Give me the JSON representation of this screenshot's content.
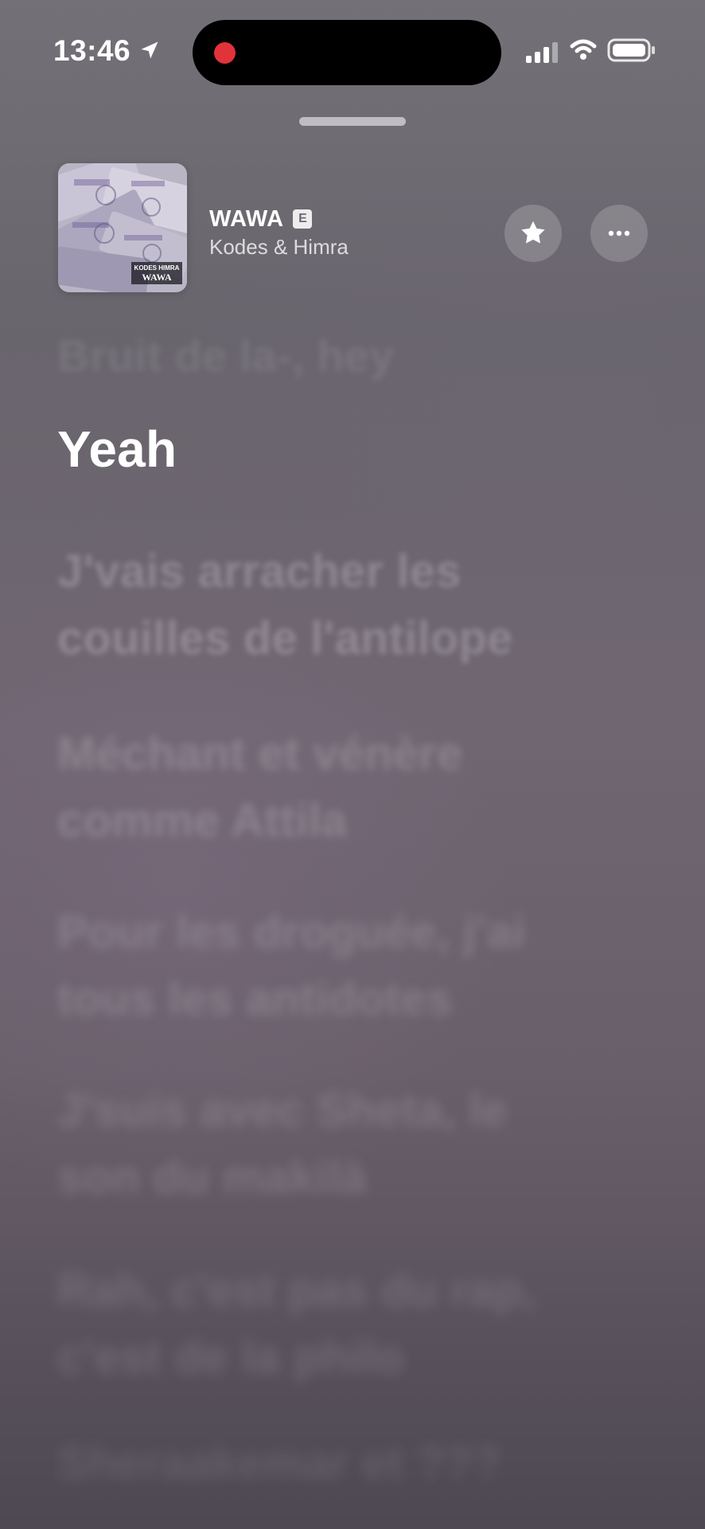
{
  "status_bar": {
    "time": "13:46",
    "location_icon": "location-arrow-icon",
    "signal_icon": "cellular-signal-icon",
    "wifi_icon": "wifi-icon",
    "battery_icon": "battery-icon",
    "recording_color": "#e2333a"
  },
  "now_playing": {
    "title": "WAWA",
    "explicit_label": "E",
    "artist": "Kodes & Himra",
    "art_text_top": "KODES HIMRA",
    "art_text_bottom": "WAWA",
    "favorite_icon": "star-icon",
    "more_icon": "ellipsis-icon"
  },
  "lyrics": {
    "previous": "Bruit de la-, hey",
    "current": "Yeah",
    "upcoming": [
      "J'vais arracher les\ncouilles de l'antilope",
      "Méchant et vénère\ncomme Attila",
      "Pour les droguée, j'ai\ntous les antidotes",
      "J'suis avec Sheta, le\nson du makilà",
      "Rah, c'est pas du rap,\nc'est de la philo",
      "Sheraakemar et ???"
    ]
  }
}
